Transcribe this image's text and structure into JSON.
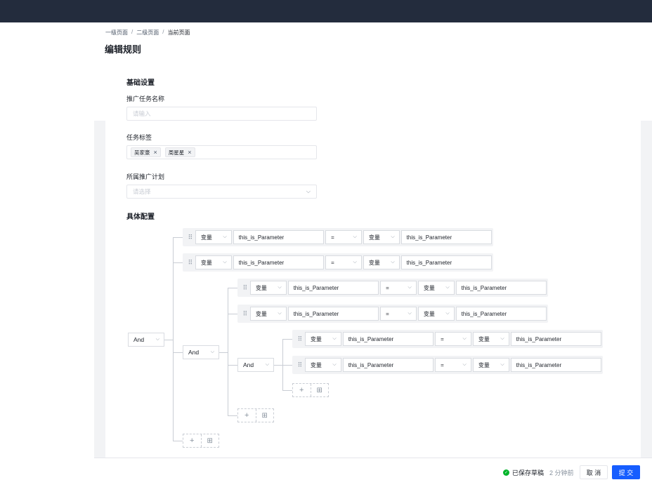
{
  "breadcrumb": [
    "一级页面",
    "二级页面",
    "当前页面"
  ],
  "page_title": "编辑规则",
  "basic": {
    "title": "基础设置",
    "task_name_label": "推广任务名称",
    "task_name_placeholder": "请输入",
    "tags_label": "任务标签",
    "tags": [
      "吴家豪",
      "周星星"
    ],
    "plan_label": "所属推广计划",
    "plan_placeholder": "请选择"
  },
  "config": {
    "title": "具体配置",
    "and_label": "And",
    "row": {
      "type": "变量",
      "param": "this_is_Parameter",
      "op": "=",
      "type2": "变量",
      "param2": "this_is_Parameter"
    }
  },
  "footer": {
    "saved_text": "已保存草稿",
    "saved_time": "2 分钟前",
    "cancel": "取 消",
    "submit": "提 交"
  },
  "colors": {
    "topbar": "#232c3d",
    "primary": "#165dff",
    "success": "#00b42a"
  }
}
